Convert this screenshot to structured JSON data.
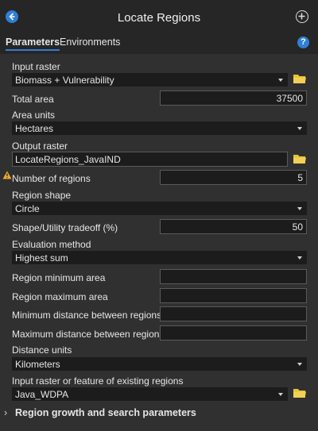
{
  "header": {
    "title": "Locate Regions"
  },
  "tabs": {
    "parameters": "Parameters",
    "environments": "Environments"
  },
  "help": "?",
  "form": {
    "input_raster": {
      "label": "Input raster",
      "value": "Biomass + Vulnerability"
    },
    "total_area": {
      "label": "Total area",
      "value": "37500"
    },
    "area_units": {
      "label": "Area units",
      "value": "Hectares"
    },
    "output_raster": {
      "label": "Output raster",
      "value": "LocateRegions_JavaIND"
    },
    "number_of_regions": {
      "label": "Number of regions",
      "value": "5"
    },
    "region_shape": {
      "label": "Region shape",
      "value": "Circle"
    },
    "shape_tradeoff": {
      "label": "Shape/Utility tradeoff (%)",
      "value": "50"
    },
    "evaluation_method": {
      "label": "Evaluation method",
      "value": "Highest sum"
    },
    "region_min_area": {
      "label": "Region minimum area",
      "value": ""
    },
    "region_max_area": {
      "label": "Region maximum area",
      "value": ""
    },
    "min_distance": {
      "label": "Minimum distance between regions",
      "value": ""
    },
    "max_distance": {
      "label": "Maximum distance between regions",
      "value": ""
    },
    "distance_units": {
      "label": "Distance units",
      "value": "Kilometers"
    },
    "existing_regions": {
      "label": "Input raster or feature of existing regions",
      "value": "Java_WDPA"
    }
  },
  "sections": {
    "region_growth": "Region growth and search parameters"
  },
  "icons": {
    "back": "back-arrow-icon",
    "add": "add-circle-icon",
    "help": "help-icon",
    "folder": "folder-icon",
    "warning": "warning-icon",
    "dropdown": "chevron-down-icon",
    "expand": "chevron-right-icon"
  },
  "colors": {
    "accent": "#2f7fd6",
    "folder": "#e8c13a",
    "warning": "#f0a830"
  }
}
